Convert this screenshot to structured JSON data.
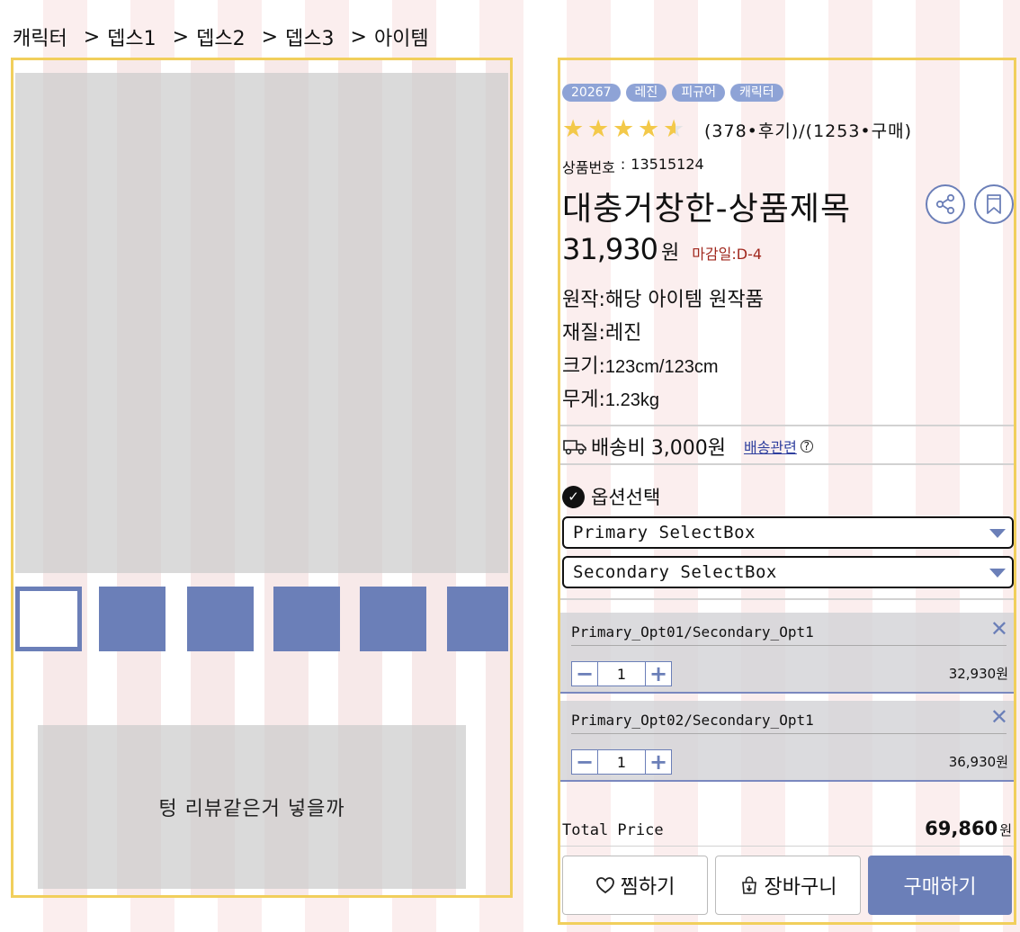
{
  "breadcrumb": {
    "items": [
      "캐릭터",
      "뎁스1",
      "뎁스2",
      "뎁스3",
      "아이템"
    ],
    "separator": ">"
  },
  "gallery": {
    "review_placeholder": "텅  리뷰같은거  넣을까",
    "thumbnails": [
      "selected",
      "image",
      "image",
      "image",
      "image",
      "image"
    ]
  },
  "product": {
    "tags": [
      "20267",
      "레진",
      "피규어",
      "캐릭터"
    ],
    "rating": 4.5,
    "rating_text": "(378•후기)/(1253•구매)",
    "product_no_label": "상품번호",
    "product_no_sep": ":",
    "product_no": "13515124",
    "title": "대충거창한-상품제목",
    "price": "31,930",
    "currency": "원",
    "deadline": "마감일:D-4",
    "specs": {
      "origin_label": "원작:",
      "origin_value": "해당 아이템 원작품",
      "material_label": "재질:",
      "material_value": "레진",
      "size_label": "크기:",
      "size_value": "123cm/123cm",
      "weight_label": "무게:",
      "weight_value": "1.23kg"
    }
  },
  "shipping": {
    "fee_label": "배송비",
    "fee_value": "3,000원",
    "link": "배송관련",
    "help_icon": "?"
  },
  "options": {
    "heading": "옵션선택",
    "primary_select": "Primary SelectBox",
    "secondary_select": "Secondary SelectBox",
    "selected": [
      {
        "name": "Primary_Opt01/Secondary_Opt1",
        "qty": "1",
        "price": "32,930원"
      },
      {
        "name": "Primary_Opt02/Secondary_Opt1",
        "qty": "1",
        "price": "36,930원"
      }
    ]
  },
  "total": {
    "label": "Total Price",
    "value": "69,860",
    "currency": "원"
  },
  "actions": {
    "wishlist": "찜하기",
    "cart": "장바구니",
    "buy": "구매하기"
  },
  "colors": {
    "accent": "#6b7fb8",
    "highlight_border": "#f1cf5c",
    "star": "#f3c94a",
    "deadline": "#a0271d",
    "tag_bg": "#8ea3d6"
  }
}
